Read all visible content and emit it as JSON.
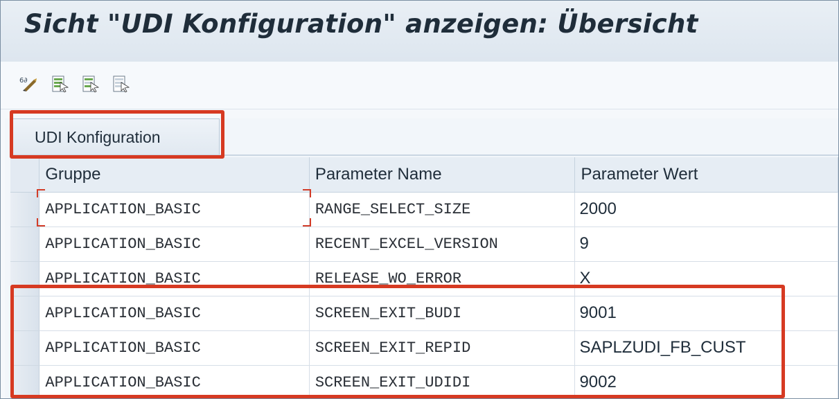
{
  "window": {
    "title": "Sicht \"UDI Konfiguration\" anzeigen: Übersicht"
  },
  "toolbar": {
    "buttons": [
      {
        "icon": "display-change-icon"
      },
      {
        "icon": "select-all-icon"
      },
      {
        "icon": "select-block-icon"
      },
      {
        "icon": "deselect-all-icon"
      }
    ]
  },
  "panel": {
    "tab_label": "UDI Konfiguration"
  },
  "table": {
    "headers": [
      "Gruppe",
      "Parameter Name",
      "Parameter Wert"
    ],
    "rows": [
      [
        "APPLICATION_BASIC",
        "RANGE_SELECT_SIZE",
        "2000"
      ],
      [
        "APPLICATION_BASIC",
        "RECENT_EXCEL_VERSION",
        "9"
      ],
      [
        "APPLICATION_BASIC",
        "RELEASE_WO_ERROR",
        "X"
      ],
      [
        "APPLICATION_BASIC",
        "SCREEN_EXIT_BUDI",
        "9001"
      ],
      [
        "APPLICATION_BASIC",
        "SCREEN_EXIT_REPID",
        "SAPLZUDI_FB_CUST"
      ],
      [
        "APPLICATION_BASIC",
        "SCREEN_EXIT_UDIDI",
        "9002"
      ]
    ]
  },
  "colors": {
    "highlight": "#d63a22",
    "title_text": "#1f2d3a"
  }
}
